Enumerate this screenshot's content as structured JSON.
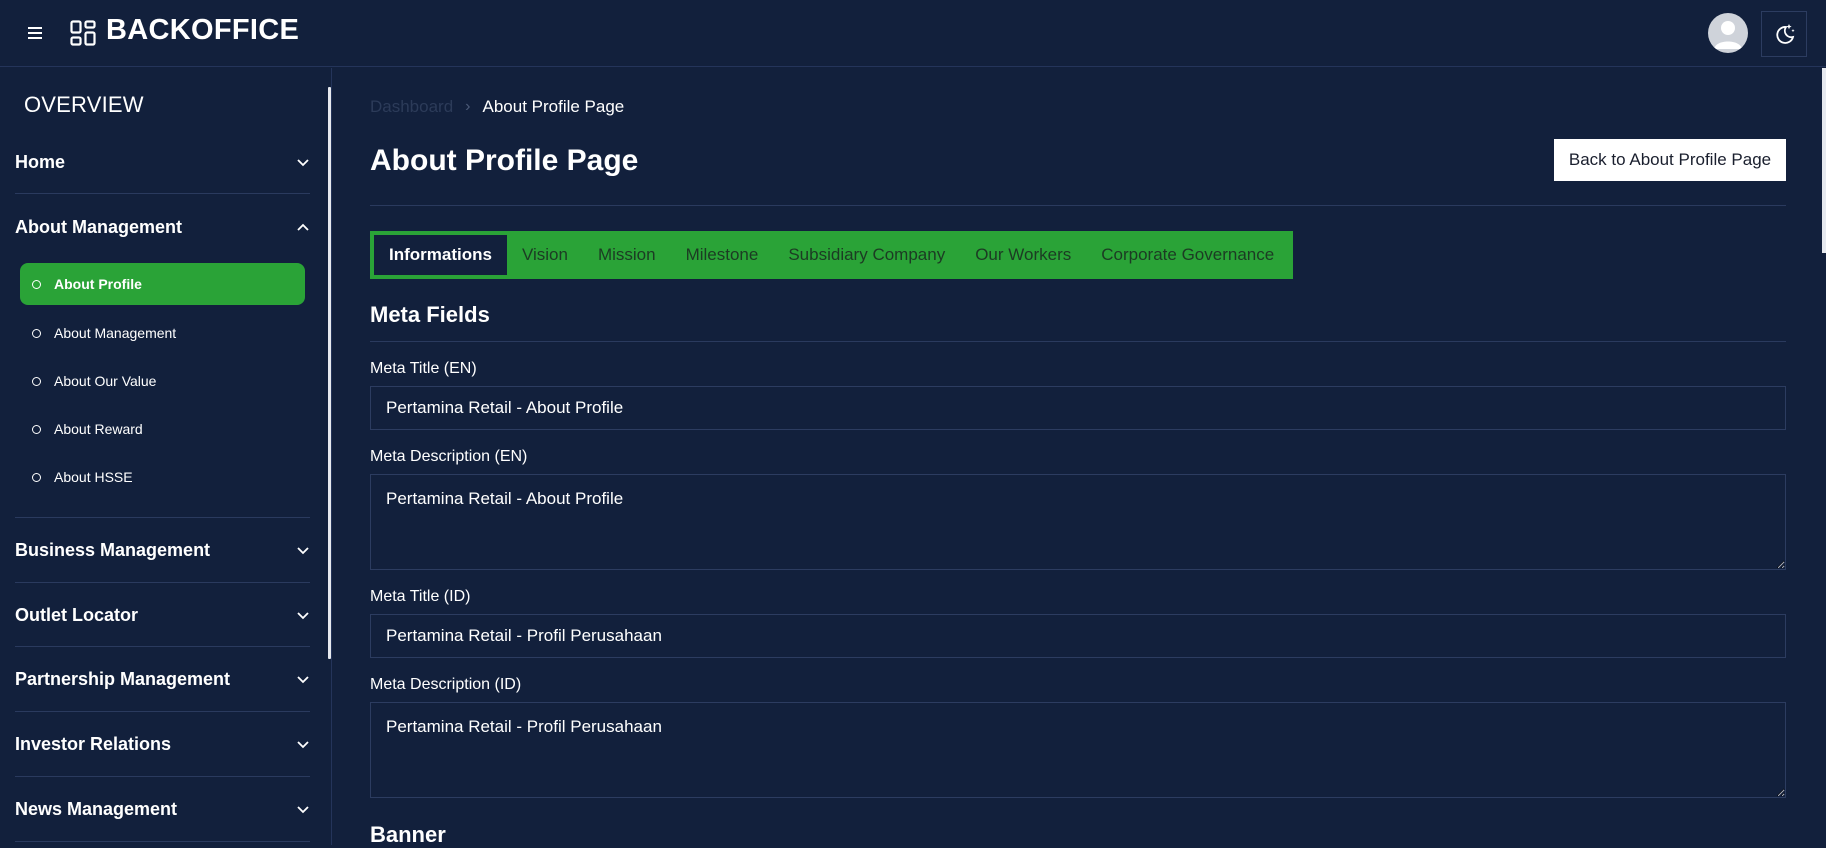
{
  "header": {
    "brand": "BACKOFFICE",
    "menu_icon": "hamburger-icon",
    "logo_icon": "grid-dashboard-icon",
    "avatar_icon": "user-avatar-icon",
    "theme_icon": "moon-stars-icon"
  },
  "sidebar": {
    "section_title": "OVERVIEW",
    "groups": [
      {
        "label": "Home",
        "expanded": false
      },
      {
        "label": "About Management",
        "expanded": true,
        "items": [
          {
            "label": "About Profile",
            "active": true
          },
          {
            "label": "About Management",
            "active": false
          },
          {
            "label": "About Our Value",
            "active": false
          },
          {
            "label": "About Reward",
            "active": false
          },
          {
            "label": "About HSSE",
            "active": false
          }
        ]
      },
      {
        "label": "Business Management",
        "expanded": false
      },
      {
        "label": "Outlet Locator",
        "expanded": false
      },
      {
        "label": "Partnership Management",
        "expanded": false
      },
      {
        "label": "Investor Relations",
        "expanded": false
      },
      {
        "label": "News Management",
        "expanded": false
      }
    ]
  },
  "breadcrumb": {
    "first": "Dashboard",
    "current": "About Profile Page"
  },
  "page": {
    "title": "About Profile Page",
    "back_button": "Back to About Profile Page"
  },
  "tabs": [
    {
      "label": "Informations",
      "active": true
    },
    {
      "label": "Vision",
      "active": false
    },
    {
      "label": "Mission",
      "active": false
    },
    {
      "label": "Milestone",
      "active": false
    },
    {
      "label": "Subsidiary Company",
      "active": false
    },
    {
      "label": "Our Workers",
      "active": false
    },
    {
      "label": "Corporate Governance",
      "active": false
    }
  ],
  "meta": {
    "section_title": "Meta Fields",
    "title_en_label": "Meta Title (EN)",
    "title_en_value": "Pertamina Retail - About Profile",
    "desc_en_label": "Meta Description (EN)",
    "desc_en_value": "Pertamina Retail - About Profile",
    "title_id_label": "Meta Title (ID)",
    "title_id_value": "Pertamina Retail - Profil Perusahaan",
    "desc_id_label": "Meta Description (ID)",
    "desc_id_value": "Pertamina Retail - Profil Perusahaan"
  },
  "banner": {
    "section_title": "Banner"
  },
  "colors": {
    "background": "#12203c",
    "accent_green": "#2aa337",
    "border": "#2c3c60"
  }
}
